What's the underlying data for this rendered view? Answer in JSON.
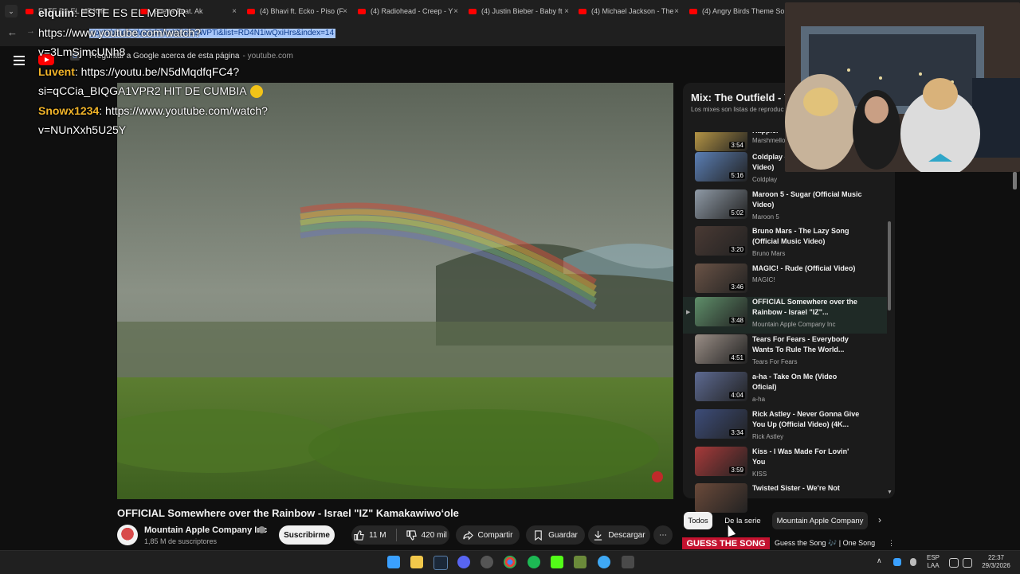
{
  "browser": {
    "tab_collapse_glyph": "⌄",
    "tabs": [
      {
        "label": "ESTE ES EL MEJOR",
        "close": "×"
      },
      {
        "label": "Guetta Feat. Ak",
        "close": "×"
      },
      {
        "label": "(4) Bhavi ft. Ecko - Piso (F",
        "close": "×"
      },
      {
        "label": "(4) Radiohead - Creep - Y",
        "close": "×"
      },
      {
        "label": "(4) Justin Bieber - Baby ft",
        "close": "×"
      },
      {
        "label": "(4) Michael Jackson - The",
        "close": "×"
      },
      {
        "label": "(4) Angry Birds Theme So",
        "close": "×"
      }
    ],
    "back_glyph": "←",
    "forward_glyph": "→",
    "address_selected": "youtube.com/watch?v=VtbH25WPTi&list=RD4N1iwQxiHrs&index=14",
    "suggestion": {
      "icon_text": "G",
      "text": "Preguntar a Google acerca de esta página",
      "domain": "- youtube.com"
    }
  },
  "chat": [
    {
      "user": "elquiin",
      "message": ": ESTE ES EL MEJOR",
      "extra": "https://www.youtube.com/watch?",
      "extra2": "v=3LmSjmcUNh8"
    },
    {
      "user": "Luvent",
      "message": ": https://youtu.be/N5dMqdfqFC4?",
      "extra": "si=qCCia_BIQGA1VPR2 HIT DE CUMBIA"
    },
    {
      "user": "Snowx1234",
      "message": ": https://www.youtube.com/watch?",
      "extra": "v=NUnXxh5U25Y"
    }
  ],
  "video": {
    "title": "OFFICIAL Somewhere over the Rainbow - Israel \"IZ\" Kamakawiwoʻole",
    "channel": "Mountain Apple Company Inc",
    "subscribers": "1,85 M de suscriptores",
    "subscribe_label": "Suscribirme",
    "likes": "11 M",
    "dislikes": "420 mil",
    "share_label": "Compartir",
    "save_label": "Guardar",
    "download_label": "Descargar",
    "more_glyph": "⋯"
  },
  "playlist": {
    "title": "Mix: The Outfield - Y",
    "subtitle": "Los mixes son listas de reproduc",
    "items": [
      {
        "title": "Happier",
        "channel": "Marshmello",
        "duration": "3:54",
        "thumb": "#c8a44a"
      },
      {
        "title": "Coldplay - Lifetime (Official Video)",
        "channel": "Coldplay",
        "duration": "5:16",
        "thumb": "#5b7fb5"
      },
      {
        "title": "Maroon 5 - Sugar (Official Music Video)",
        "channel": "Maroon 5",
        "duration": "5:02",
        "thumb": "#8f9aa6"
      },
      {
        "title": "Bruno Mars - The Lazy Song (Official Music Video)",
        "channel": "Bruno Mars",
        "duration": "3:20",
        "thumb": "#4a3a34"
      },
      {
        "title": "MAGIC! - Rude (Official Video)",
        "channel": "MAGIC!",
        "duration": "3:46",
        "thumb": "#6a5346"
      },
      {
        "title": "OFFICIAL Somewhere over the Rainbow - Israel \"IZ\"...",
        "channel": "Mountain Apple Company Inc",
        "duration": "3:48",
        "thumb": "#5f8f6a"
      },
      {
        "title": "Tears For Fears - Everybody Wants To Rule The World...",
        "channel": "Tears For Fears",
        "duration": "4:51",
        "thumb": "#9a8e86"
      },
      {
        "title": "a-ha - Take On Me (Video Oficial)",
        "channel": "a-ha",
        "duration": "4:04",
        "thumb": "#5d6a92"
      },
      {
        "title": "Rick Astley - Never Gonna Give You Up (Official Video) (4K...",
        "channel": "Rick Astley",
        "duration": "3:34",
        "thumb": "#3d4d7a"
      },
      {
        "title": "Kiss - I Was Made For Lovin' You",
        "channel": "KISS",
        "duration": "3:59",
        "thumb": "#a83a3a"
      },
      {
        "title": "Twisted Sister - We're Not",
        "channel": "",
        "duration": "",
        "thumb": "#6b4a3a"
      }
    ],
    "active_marker": "▶"
  },
  "chips": {
    "items": [
      "Todos",
      "De la serie",
      "Mountain Apple Company"
    ],
    "next_glyph": "›"
  },
  "ad": {
    "badge": "GUESS THE SONG",
    "text": "Guess the Song 🎶 | One Song",
    "more": "⋮"
  },
  "taskbar": {
    "lang_top": "ESP",
    "lang_bottom": "LAA",
    "time": "22:37",
    "date": "29/3/2026",
    "tray_up": "∧"
  },
  "colors": {
    "accent": "#ff0000",
    "ad_badge": "#c4122f",
    "chat_user": "#f1b429"
  }
}
